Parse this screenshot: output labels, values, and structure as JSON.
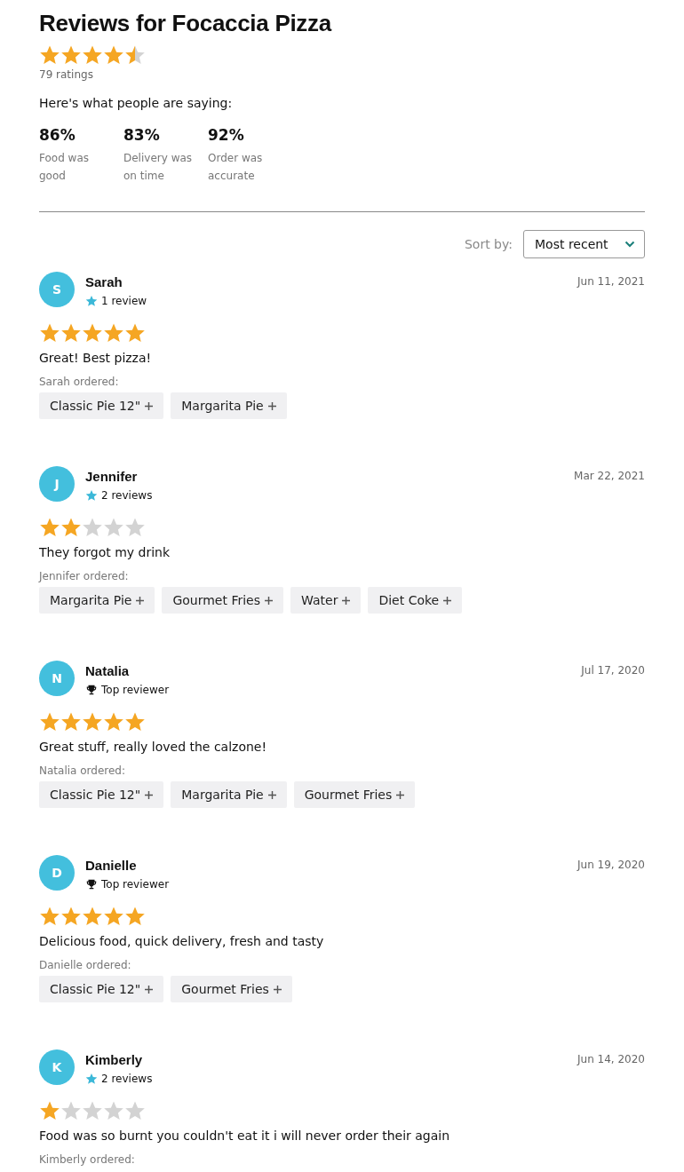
{
  "title": "Reviews for Focaccia Pizza",
  "summary": {
    "stars": 4.5,
    "ratings": "79 ratings",
    "intro": "Here's what people are saying:",
    "stats": [
      {
        "value": "86%",
        "label": "Food was good"
      },
      {
        "value": "83%",
        "label": "Delivery was on time"
      },
      {
        "value": "92%",
        "label": "Order was accurate"
      }
    ]
  },
  "sort": {
    "label": "Sort by:",
    "value": "Most recent"
  },
  "reviews": [
    {
      "initial": "S",
      "name": "Sarah",
      "badge": {
        "kind": "count",
        "text": "1 review"
      },
      "date": "Jun 11, 2021",
      "stars": 5,
      "comment": "Great! Best pizza!",
      "ordered_label": "Sarah ordered:",
      "items": [
        "Classic Pie 12\"",
        "Margarita Pie"
      ]
    },
    {
      "initial": "J",
      "name": "Jennifer",
      "badge": {
        "kind": "count",
        "text": "2 reviews"
      },
      "date": "Mar 22, 2021",
      "stars": 2,
      "comment": "They forgot my drink",
      "ordered_label": "Jennifer ordered:",
      "items": [
        "Margarita Pie",
        "Gourmet Fries",
        "Water",
        "Diet Coke"
      ]
    },
    {
      "initial": "N",
      "name": "Natalia",
      "badge": {
        "kind": "top",
        "text": "Top reviewer"
      },
      "date": "Jul 17, 2020",
      "stars": 5,
      "comment": "Great stuff, really loved the calzone!",
      "ordered_label": "Natalia ordered:",
      "items": [
        "Classic Pie 12\"",
        "Margarita Pie",
        "Gourmet Fries"
      ]
    },
    {
      "initial": "D",
      "name": "Danielle",
      "badge": {
        "kind": "top",
        "text": "Top reviewer"
      },
      "date": "Jun 19, 2020",
      "stars": 5,
      "comment": "Delicious food, quick delivery, fresh and tasty",
      "ordered_label": "Danielle ordered:",
      "items": [
        "Classic Pie 12\"",
        "Gourmet Fries"
      ]
    },
    {
      "initial": "K",
      "name": "Kimberly",
      "badge": {
        "kind": "count",
        "text": "2 reviews"
      },
      "date": "Jun 14, 2020",
      "stars": 1,
      "comment": "Food was so burnt you couldn't eat it i will never order their again",
      "ordered_label": "Kimberly ordered:"
    }
  ]
}
